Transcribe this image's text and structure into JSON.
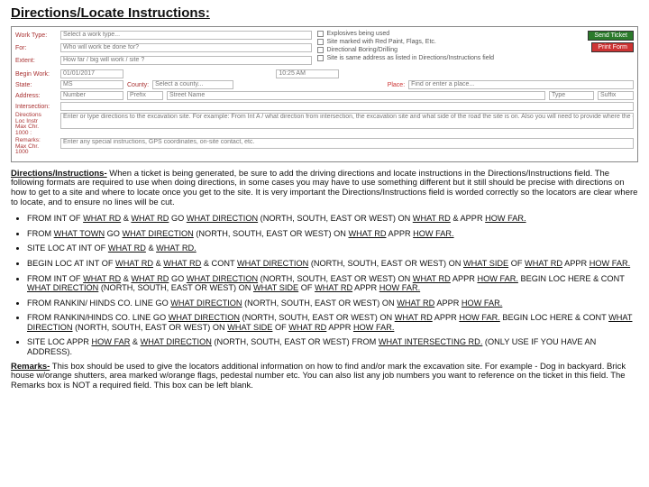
{
  "title": "Directions/Locate Instructions:",
  "form": {
    "work_type": {
      "label": "Work Type:",
      "value": "Select a work type..."
    },
    "for": {
      "label": "For:",
      "value": "Who will work be done for?"
    },
    "extent": {
      "label": "Extent:",
      "value": "How far / big will work / site ?"
    },
    "check1": "Explosives being used",
    "check2": "Site marked with Red Paint, Flags, Etc.",
    "check3": "Directional Boring/Drilling",
    "check4": "Site is same address as listed in Directions/Instructions field",
    "btn_send": "Send Ticket",
    "btn_print": "Print Form",
    "begin_work": {
      "label": "Begin Work:",
      "value": "01/01/2017"
    },
    "time": "10:25 AM",
    "state": {
      "label": "State:",
      "value": "MS"
    },
    "county": {
      "label": "County:",
      "value": "Select a county..."
    },
    "place": {
      "label": "Place:",
      "value": "Find or enter a place..."
    },
    "address": {
      "label": "Address:"
    },
    "num": "Number",
    "prefix": "Prefix",
    "street": "Street Name",
    "type": "Type",
    "suffix": "Suffix",
    "intersection": {
      "label": "Intersection:"
    },
    "directions": {
      "label": "Directions<br>Loc Instr<br>Max Chr.<br>1000 :",
      "value": "Enter or type directions to the excavation site. For example: From Int A / what direction from intersection, the excavation site and what side of the road the site is on. Also you will need to provide where the excavator will take place."
    },
    "remarks_f": {
      "label": "Remarks:<br>Max Chr.<br>1000",
      "value": "Enter any special instructions, GPS coordinates, on-site contact, etc."
    }
  },
  "intro": {
    "lead": "Directions/Instructions-",
    "body": " When a ticket is being generated, be sure to add the driving directions and locate instructions in the Directions/Instructions field. The following formats are required to use when doing directions, in some cases you may have to use something different but it still should be precise with directions on how to get to a site and where to locate once you get to the site. It is very important the Directions/Instructions field is worded correctly so the locators are clear where to locate, and to ensure no lines will be cut."
  },
  "bul": {
    "b1a": "FROM INT OF ",
    "b1b": "WHAT RD",
    "b1c": " & ",
    "b1d": "WHAT RD",
    "b1e": " GO ",
    "b1f": "WHAT DIRECTION",
    "b1g": " (NORTH, SOUTH, EAST OR WEST) ON ",
    "b1h": "WHAT RD",
    "b1i": " & APPR ",
    "b1j": "HOW FAR.",
    "b2a": "FROM ",
    "b2b": "WHAT TOWN",
    "b2c": " GO ",
    "b2d": "WHAT DIRECTION",
    "b2e": " (NORTH, SOUTH, EAST OR WEST) ON ",
    "b2f": "WHAT RD",
    "b2g": " APPR ",
    "b2h": "HOW FAR.",
    "b3a": "SITE LOC AT INT OF ",
    "b3b": "WHAT RD",
    "b3c": " & ",
    "b3d": "WHAT RD.",
    "b4a": "BEGIN LOC AT INT OF ",
    "b4b": "WHAT RD",
    "b4c": " & ",
    "b4d": "WHAT RD",
    "b4e": " & CONT ",
    "b4f": "WHAT DIRECTION",
    "b4g": " (NORTH, SOUTH, EAST OR WEST) ON ",
    "b4h": "WHAT SIDE",
    "b4i": " OF ",
    "b4j": "WHAT RD",
    "b4k": " APPR ",
    "b4l": "HOW FAR.",
    "b5a": "FROM INT OF ",
    "b5b": "WHAT RD",
    "b5c": " & ",
    "b5d": "WHAT RD",
    "b5e": " GO ",
    "b5f": "WHAT DIRECTION",
    "b5g": " (NORTH, SOUTH, EAST OR WEST) ON ",
    "b5h": "WHAT RD",
    "b5i": " APPR ",
    "b5j": "HOW FAR.",
    "b5k": " BEGIN LOC HERE & CONT ",
    "b5l": "WHAT DIRECTION",
    "b5m": " (NORTH, SOUTH, EAST OR WEST) ON ",
    "b5n": "WHAT SIDE",
    "b5o": " OF ",
    "b5p": "WHAT RD",
    "b5q": " APPR ",
    "b5r": "HOW FAR.",
    "b6a": "FROM RANKIN/ HINDS CO. LINE GO ",
    "b6b": "WHAT DIRECTION",
    "b6c": " (NORTH, SOUTH, EAST OR WEST) ON ",
    "b6d": "WHAT RD",
    "b6e": " APPR ",
    "b6f": "HOW FAR.",
    "b7a": "FROM RANKIN/HINDS CO. LINE GO ",
    "b7b": "WHAT DIRECTION",
    "b7c": " (NORTH, SOUTH, EAST OR WEST) ON ",
    "b7d": "WHAT RD",
    "b7e": " APPR ",
    "b7f": "HOW FAR.",
    "b7g": " BEGIN LOC HERE & CONT ",
    "b7h": "WHAT DIRECTION",
    "b7i": " (NORTH, SOUTH, EAST OR WEST) ON ",
    "b7j": "WHAT SIDE",
    "b7k": " OF ",
    "b7l": "WHAT RD",
    "b7m": " APPR ",
    "b7n": "HOW FAR.",
    "b8a": "SITE LOC APPR ",
    "b8b": "HOW FAR",
    "b8c": " & ",
    "b8d": "WHAT DIRECTION",
    "b8e": " (NORTH, SOUTH, EAST OR WEST) FROM ",
    "b8f": "WHAT INTERSECTING RD.",
    "b8g": " (ONLY USE IF YOU HAVE AN ADDRESS)."
  },
  "remarks": {
    "lead": "Remarks-",
    "body": " This box should be used to give the locators additional information on how to find and/or mark the excavation site. For example - Dog in backyard.  Brick house w/orange shutters, area marked w/orange flags, pedestal number etc.  You can also list any job numbers you want to reference on the ticket in this field.  The Remarks box is NOT a required field. This box can be left blank."
  }
}
